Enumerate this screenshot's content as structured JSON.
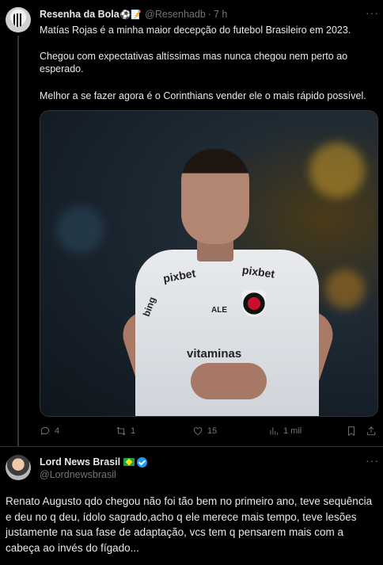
{
  "tweet1": {
    "display_name": "Resenha da Bola",
    "name_emojis": "⚽📝",
    "handle": "@Resenhadb",
    "time": "7 h",
    "paragraphs": [
      "Matías Rojas é a minha maior decepção do futebol Brasileiro em 2023.",
      "Chegou com expectativas altíssimas mas nunca chegou nem perto ao esperado.",
      "Melhor a se fazer agora é o Corinthians vender ele o mais rápido possível."
    ],
    "media": {
      "sponsor_left": "pixbet",
      "sponsor_right": "pixbet",
      "sponsor_chest": "vitaminas",
      "sponsor_sleeve": "bing",
      "sponsor_ale": "ALE"
    },
    "stats": {
      "replies": "4",
      "reposts": "1",
      "likes": "15",
      "views": "1 mil"
    }
  },
  "tweet2": {
    "display_name": "Lord News Brasil",
    "handle": "@Lordnewsbrasil",
    "text": "Renato Augusto qdo chegou não foi tão bem no primeiro ano, teve sequência e deu no q deu, ídolo sagrado,acho q ele merece mais tempo, teve lesões justamente na sua fase de adaptação, vcs tem q pensarem mais com a cabeça ao invés do fígado..."
  },
  "more_icon": "···",
  "colors": {
    "background": "#000000",
    "text": "#e7e9ea",
    "muted": "#71767b",
    "accent": "#1d9bf0"
  }
}
